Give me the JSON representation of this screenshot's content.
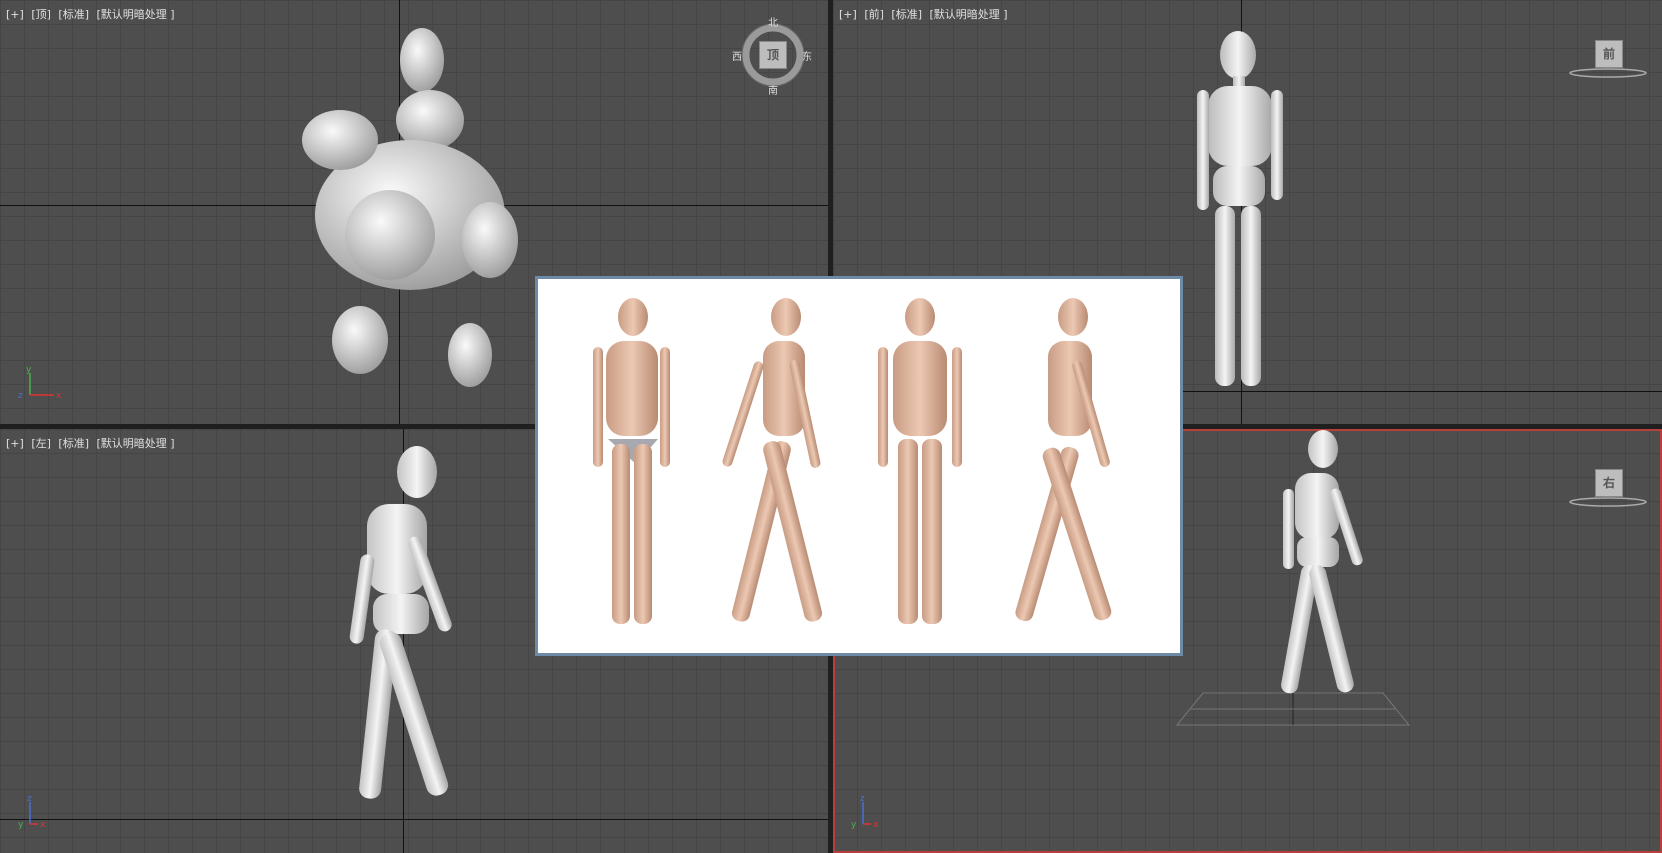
{
  "viewports": {
    "top": {
      "label_plus": "[+]",
      "label_view": "[顶]",
      "label_shading": "[标准]",
      "label_light": "[默认明暗处理 ]",
      "cube_face": "顶",
      "compass": {
        "n": "北",
        "s": "南",
        "e": "东",
        "w": "西"
      }
    },
    "front": {
      "label_plus": "[+]",
      "label_view": "[前]",
      "label_shading": "[标准]",
      "label_light": "[默认明暗处理 ]",
      "cube_face": "前"
    },
    "left": {
      "label_plus": "[+]",
      "label_view": "[左]",
      "label_shading": "[标准]",
      "label_light": "[默认明暗处理 ]"
    },
    "perspective": {
      "cube_face": "右"
    }
  },
  "axes": {
    "x": "x",
    "y": "y",
    "z": "z"
  },
  "colors": {
    "viewport_bg": "#4e4e4e",
    "active_border": "#b8403c",
    "panel_border": "#6d8aa6",
    "mannequin": "#e6e6e6",
    "skin": "#d9b29a"
  },
  "icons": [
    "viewcube-icon",
    "compass-ring-icon",
    "axis-triad-icon"
  ]
}
